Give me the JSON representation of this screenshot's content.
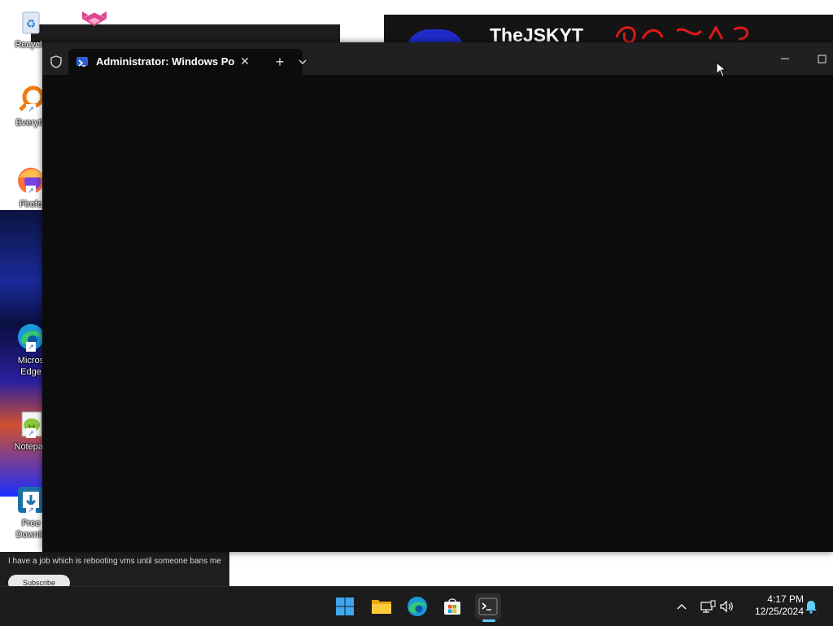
{
  "desktop": {
    "icons": [
      {
        "label": "Recycle",
        "icon": "recycle-bin-icon"
      },
      {
        "label": "Everyth",
        "icon": "everything-search-icon"
      },
      {
        "label": "Firefo",
        "icon": "firefox-icon"
      },
      {
        "label": "Micros",
        "label2": "Edge",
        "icon": "edge-icon"
      },
      {
        "label": "Notepac",
        "icon": "notepad-plus-plus-icon"
      },
      {
        "label": "Free",
        "label2": "Downlo",
        "icon": "free-download-manager-icon"
      }
    ],
    "banner_text": "TheJSKYT",
    "bottom_text": "I have a job which is rebooting vms until someone bans me",
    "bottom_pill": "Subscribe"
  },
  "terminal": {
    "tab_title": "Administrator: Windows PowerShell",
    "new_tab_symbol": "+",
    "close_symbol": "✕"
  },
  "taskbar": {
    "apps": [
      {
        "name": "start",
        "icon": "windows-start-icon"
      },
      {
        "name": "file-explorer",
        "icon": "folder-icon"
      },
      {
        "name": "edge",
        "icon": "edge-icon"
      },
      {
        "name": "store",
        "icon": "store-icon"
      },
      {
        "name": "terminal",
        "icon": "terminal-icon",
        "active": true
      }
    ],
    "time": "4:17 PM",
    "date": "12/25/2024"
  },
  "colors": {
    "accent": "#60cdff",
    "terminal_bg": "#0c0c0c",
    "titlebar_bg": "#202020",
    "taskbar_bg": "#1c1c1c"
  }
}
